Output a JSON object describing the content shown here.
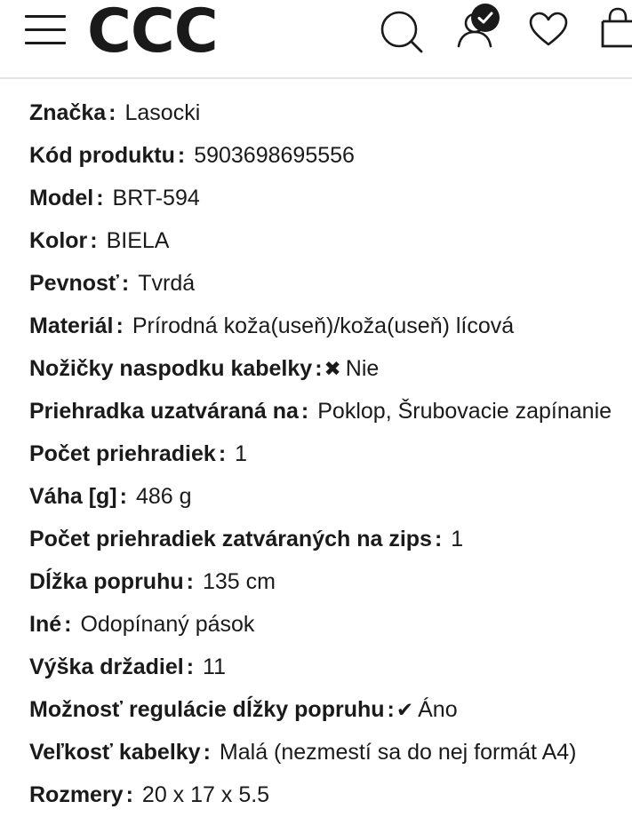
{
  "header": {
    "logo": "CCC",
    "icons": {
      "menu": "hamburger-menu-icon",
      "search": "search-icon",
      "account": "user-account-icon",
      "account_badge": "check-icon",
      "wishlist": "heart-icon",
      "cart": "shopping-bag-icon"
    }
  },
  "specs": [
    {
      "label": "Značka",
      "value": "Lasocki",
      "mark": ""
    },
    {
      "label": "Kód produktu",
      "value": "5903698695556",
      "mark": ""
    },
    {
      "label": "Model",
      "value": "BRT-594",
      "mark": ""
    },
    {
      "label": "Kolor",
      "value": "BIELA",
      "mark": ""
    },
    {
      "label": "Pevnosť",
      "value": "Tvrdá",
      "mark": ""
    },
    {
      "label": "Materiál",
      "value": "Prírodná koža(useň)/koža(useň) lícová",
      "mark": ""
    },
    {
      "label": "Nožičky naspodku kabelky",
      "value": "Nie",
      "mark": "✖"
    },
    {
      "label": "Priehradka uzatváraná na",
      "value": "Poklop, Šrubovacie zapínanie",
      "mark": ""
    },
    {
      "label": "Počet priehradiek",
      "value": "1",
      "mark": ""
    },
    {
      "label": "Váha [g]",
      "value": "486 g",
      "mark": ""
    },
    {
      "label": "Počet priehradiek zatváraných na zips",
      "value": "1",
      "mark": ""
    },
    {
      "label": "Dĺžka popruhu",
      "value": "135 cm",
      "mark": ""
    },
    {
      "label": "Iné",
      "value": "Odopínaný pások",
      "mark": ""
    },
    {
      "label": "Výška držadiel",
      "value": "11",
      "mark": ""
    },
    {
      "label": "Možnosť regulácie dĺžky popruhu",
      "value": "Áno",
      "mark": "✔"
    },
    {
      "label": "Veľkosť kabelky",
      "value": "Malá (nezmestí sa do nej formát A4)",
      "mark": ""
    },
    {
      "label": "Rozmery",
      "value": "20 x 17 x 5.5",
      "mark": ""
    }
  ]
}
